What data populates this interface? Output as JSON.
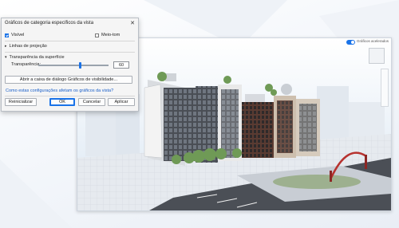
{
  "dialog": {
    "title": "Gráficos de categoria específicos da vista",
    "close_glyph": "✕",
    "visible_label": "Visível",
    "visible_checked": true,
    "halftone_label": "Meio-tom",
    "halftone_checked": false,
    "projection_lines_label": "Linhas de projeção",
    "surface_transparency_label": "Transparência da superfície",
    "transparency_label": "Transparência:",
    "transparency_value": "60",
    "transparency_fraction": 0.6,
    "open_vg_button": "Abrir a caixa de diálogo Gráficos de visibilidade...",
    "help_link": "Como estas configurações afetam os gráficos da vista?",
    "reset_button": "Reinicializar",
    "ok_button": "OK",
    "cancel_button": "Cancelar",
    "apply_button": "Aplicar"
  },
  "viewport": {
    "accelerated_graphics_label": "Gráficos acelerados",
    "accelerated_graphics_on": true
  },
  "colors": {
    "accent": "#1a73e8",
    "link": "#1a5fc8",
    "sky": "#d8e6f4"
  }
}
